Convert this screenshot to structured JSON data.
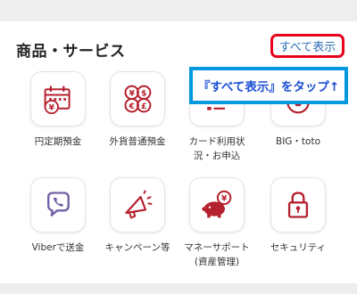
{
  "section": {
    "title": "商品・サービス",
    "view_all_label": "すべて表示"
  },
  "callout": {
    "text": "『すべて表示』をタップ↑"
  },
  "colors": {
    "icon_red": "#b5202e",
    "link_blue": "#2f6fb3",
    "highlight_red": "#e8001c",
    "callout_blue": "#0099e0",
    "viber_purple": "#7360a8"
  },
  "services": [
    {
      "label": "円定期預金",
      "icon": "calendar-yen-icon"
    },
    {
      "label": "外貨普通預金",
      "icon": "currency-coins-icon"
    },
    {
      "label": "カード利用状\n況・お申込",
      "icon": "card-list-icon"
    },
    {
      "label": "BIG・toto",
      "icon": "soccer-ball-icon"
    },
    {
      "label": "Viberで送金",
      "icon": "viber-icon"
    },
    {
      "label": "キャンペーン等",
      "icon": "megaphone-icon"
    },
    {
      "label": "マネーサポート\n(資産管理)",
      "icon": "piggy-bank-icon"
    },
    {
      "label": "セキュリティ",
      "icon": "lock-icon"
    }
  ]
}
